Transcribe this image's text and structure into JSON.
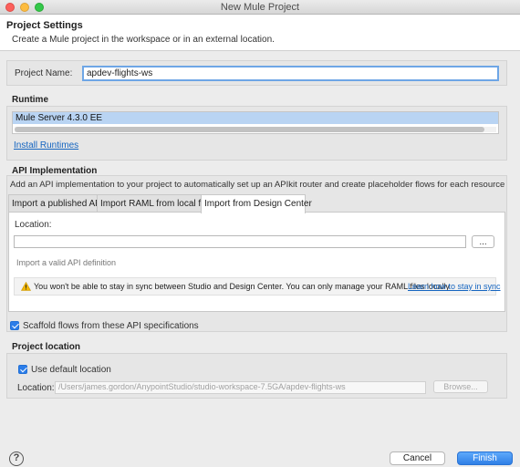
{
  "window": {
    "title": "New Mule Project"
  },
  "header": {
    "title": "Project Settings",
    "description": "Create a Mule project in the workspace or in an external location."
  },
  "project": {
    "name_label": "Project Name:",
    "name_value": "apdev-flights-ws"
  },
  "runtime": {
    "title": "Runtime",
    "items": [
      "Mule Server 4.3.0 EE"
    ],
    "install_link": "Install Runtimes"
  },
  "api": {
    "title": "API Implementation",
    "description": "Add an API implementation to your project to automatically set up an APIkit router and create placeholder flows for each resource method",
    "tabs": [
      "Import a published API",
      "Import RAML from local file",
      "Import from Design Center"
    ],
    "active_tab": "Import from Design Center",
    "location_label": "Location:",
    "location_value": "",
    "browse_button": "...",
    "hint": "Import a valid API definition",
    "warning_text": "You won't be able to stay in sync between Studio and Design Center. You can only manage your RAML files locally",
    "warning_link": "Learn how to stay in sync",
    "scaffold_label": "Scaffold flows from these API specifications",
    "scaffold_checked": true
  },
  "location": {
    "title": "Project location",
    "use_default_label": "Use default location",
    "use_default_checked": true,
    "label": "Location:",
    "value": "/Users/james.gordon/AnypointStudio/studio-workspace-7.5GA/apdev-flights-ws",
    "browse_button": "Browse..."
  },
  "footer": {
    "help": "?",
    "cancel": "Cancel",
    "finish": "Finish"
  },
  "colors": {
    "accent": "#2f7fe6",
    "selection": "#b9d4f3",
    "link": "#1565c0"
  }
}
